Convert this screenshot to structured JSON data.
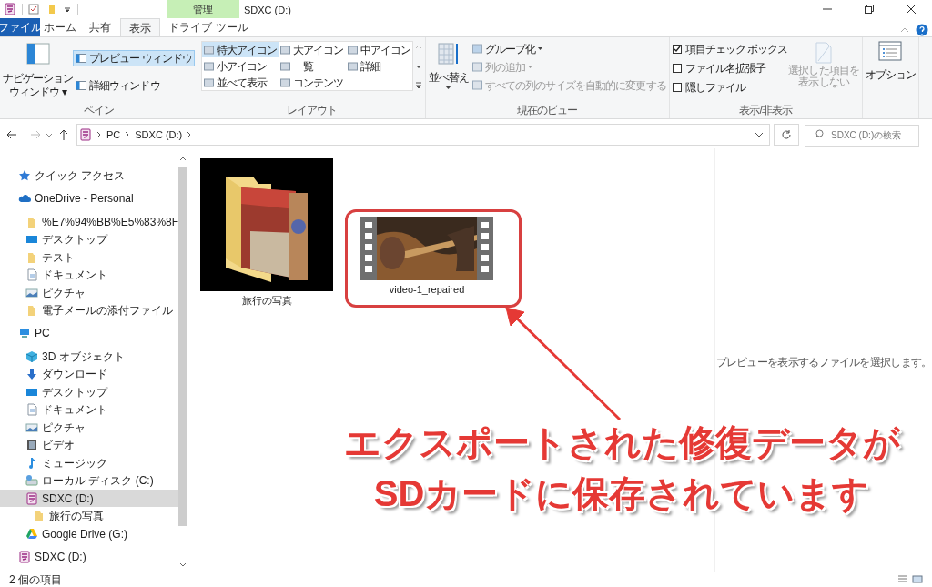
{
  "window": {
    "title": "SDXC (D:)",
    "context_header": "管理"
  },
  "tabs": [
    {
      "label": "ファイル",
      "kind": "file",
      "selected": false
    },
    {
      "label": "ホーム",
      "kind": "plain",
      "selected": false
    },
    {
      "label": "共有",
      "kind": "plain",
      "selected": false
    },
    {
      "label": "表示",
      "kind": "plain",
      "selected": true
    },
    {
      "label": "ドライブ ツール",
      "kind": "context",
      "selected": false
    }
  ],
  "ribbon": {
    "pane": {
      "label": "ペイン",
      "navigation": [
        "ナビゲーション",
        "ウィンドウ ▾"
      ],
      "preview": {
        "label": "プレビュー ウィンドウ",
        "selected": true
      },
      "details": {
        "label": "詳細ウィンドウ",
        "selected": false
      }
    },
    "layout": {
      "label": "レイアウト",
      "items": [
        {
          "label": "特大アイコン",
          "selected": true
        },
        {
          "label": "大アイコン",
          "selected": false
        },
        {
          "label": "中アイコン",
          "selected": false
        },
        {
          "label": "小アイコン",
          "selected": false
        },
        {
          "label": "一覧",
          "selected": false
        },
        {
          "label": "詳細",
          "selected": false
        },
        {
          "label": "並べて表示",
          "selected": false
        },
        {
          "label": "コンテンツ",
          "selected": false
        }
      ]
    },
    "current_view": {
      "label": "現在のビュー",
      "sort": "並べ替え",
      "items": [
        {
          "label": "グループ化",
          "dropdown": true,
          "disabled": false
        },
        {
          "label": "列の追加",
          "dropdown": true,
          "disabled": true
        },
        {
          "label": "すべての列のサイズを自動的に変更する",
          "dropdown": false,
          "disabled": true
        }
      ]
    },
    "show_hide": {
      "label": "表示/非表示",
      "checkboxes": [
        {
          "label": "項目チェック ボックス",
          "checked": true
        },
        {
          "label": "ファイル名拡張子",
          "checked": false
        },
        {
          "label": "隠しファイル",
          "checked": false
        }
      ],
      "hide_selected": {
        "lines": [
          "選択した項目を",
          "表示しない"
        ],
        "disabled": true
      }
    },
    "options": {
      "label": "オプション"
    }
  },
  "address": {
    "path": [
      "PC",
      "SDXC (D:)"
    ],
    "search_placeholder": "SDXC (D:)の検索"
  },
  "sidebar": {
    "items": [
      {
        "label": "クイック アクセス",
        "kind": "star",
        "selected": false
      },
      {
        "label": "OneDrive - Personal",
        "kind": "cloud",
        "selected": false,
        "children": [
          {
            "label": "%E7%94%BB%E5%83%8F",
            "kind": "folder",
            "selected": false
          },
          {
            "label": "デスクトップ",
            "kind": "desktop",
            "selected": false
          },
          {
            "label": "テスト",
            "kind": "folder",
            "selected": false
          },
          {
            "label": "ドキュメント",
            "kind": "document",
            "selected": false
          },
          {
            "label": "ピクチャ",
            "kind": "picture",
            "selected": false
          },
          {
            "label": "電子メールの添付ファイル",
            "kind": "folder",
            "selected": false
          }
        ]
      },
      {
        "label": "PC",
        "kind": "pc",
        "selected": false,
        "children": [
          {
            "label": "3D オブジェクト",
            "kind": "cube",
            "selected": false
          },
          {
            "label": "ダウンロード",
            "kind": "download",
            "selected": false
          },
          {
            "label": "デスクトップ",
            "kind": "desktop",
            "selected": false
          },
          {
            "label": "ドキュメント",
            "kind": "document",
            "selected": false
          },
          {
            "label": "ピクチャ",
            "kind": "picture",
            "selected": false
          },
          {
            "label": "ビデオ",
            "kind": "video",
            "selected": false
          },
          {
            "label": "ミュージック",
            "kind": "music",
            "selected": false
          },
          {
            "label": "ローカル ディスク (C:)",
            "kind": "disk",
            "selected": false
          },
          {
            "label": "SDXC (D:)",
            "kind": "sd",
            "selected": true,
            "children": [
              {
                "label": "旅行の写真",
                "kind": "folder",
                "selected": false
              }
            ]
          },
          {
            "label": "Google Drive (G:)",
            "kind": "gdrive",
            "selected": false
          }
        ]
      },
      {
        "label": "SDXC (D:)",
        "kind": "sd",
        "selected": false
      }
    ]
  },
  "files": [
    {
      "name": "旅行の写真",
      "kind": "folder"
    },
    {
      "name": "video-1_repaired",
      "kind": "video",
      "highlighted": true
    }
  ],
  "preview_message": "プレビューを表示するファイルを選択します。",
  "annotation": {
    "lines": [
      "エクスポートされた修復データが",
      "SDカードに保存されています"
    ]
  },
  "status_bar": {
    "item_count": "2 個の項目"
  }
}
